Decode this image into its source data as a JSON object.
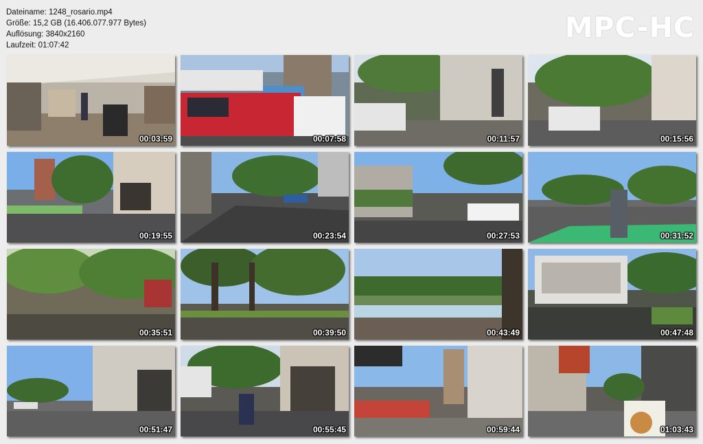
{
  "file_info": {
    "filename": "Dateiname: 1248_rosario.mp4",
    "size": "Größe: 15,2 GB (16.406.077.977 Bytes)",
    "resolution": "Auflösung: 3840x2160",
    "duration": "Laufzeit: 01:07:42"
  },
  "logo": "MPC-HC",
  "thumbnails": [
    {
      "time": "00:03:59"
    },
    {
      "time": "00:07:58"
    },
    {
      "time": "00:11:57"
    },
    {
      "time": "00:15:56"
    },
    {
      "time": "00:19:55"
    },
    {
      "time": "00:23:54"
    },
    {
      "time": "00:27:53"
    },
    {
      "time": "00:31:52"
    },
    {
      "time": "00:35:51"
    },
    {
      "time": "00:39:50"
    },
    {
      "time": "00:43:49"
    },
    {
      "time": "00:47:48"
    },
    {
      "time": "00:51:47"
    },
    {
      "time": "00:55:45"
    },
    {
      "time": "00:59:44"
    },
    {
      "time": "01:03:43"
    }
  ],
  "colors": {
    "background": "#ededed",
    "timestamp": "#ffffff",
    "logo": "#ffffff"
  }
}
